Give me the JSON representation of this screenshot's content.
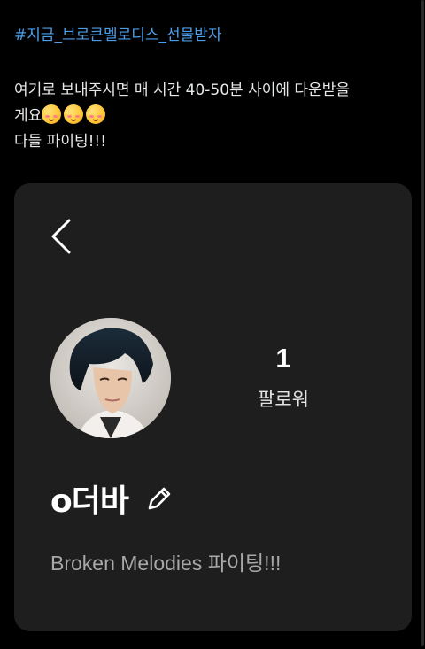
{
  "post": {
    "hashtag": "#지금_브로큰멜로디스_선물받자",
    "text_line1": "여기로 보내주시면 매 시간 40-50분 사이에 다운받을",
    "text_line2": "게요",
    "text_line3": "다들 파이팅!!!",
    "emoji_icon": "smiling-face-with-hearts"
  },
  "profile": {
    "followers_count": "1",
    "followers_label": "팔로워",
    "nickname": "o더바",
    "bio": "Broken Melodies 파이팅!!!"
  },
  "colors": {
    "background": "#000000",
    "card": "#1e1e1e",
    "hashtag": "#4a9eea",
    "text": "#e7e9ea",
    "bio": "#a8a8a8"
  },
  "icons": {
    "back": "chevron-left-icon",
    "edit": "pencil-icon"
  }
}
